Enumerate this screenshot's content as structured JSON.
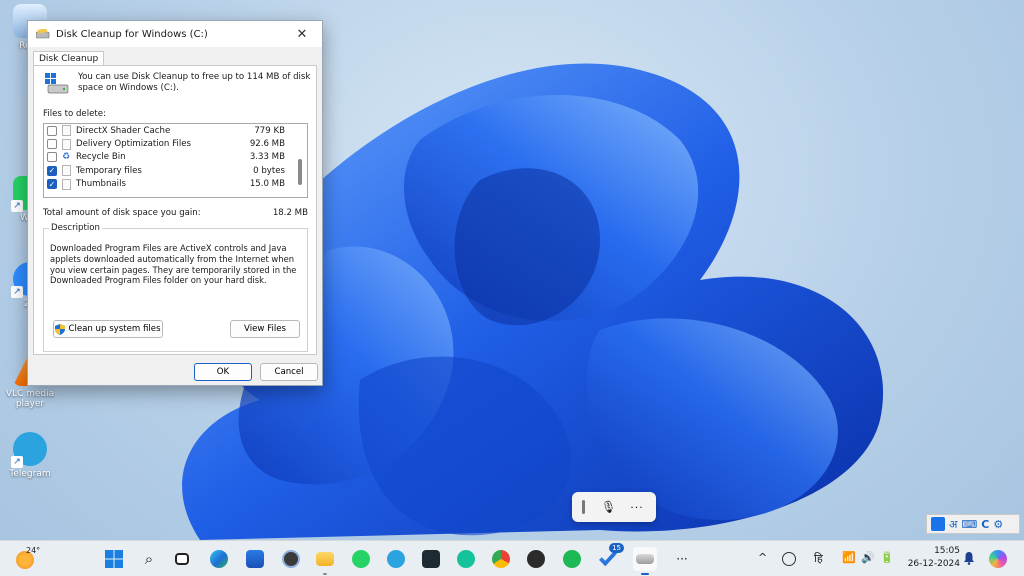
{
  "desktop": {
    "icons": [
      {
        "label": "Recy",
        "name": "recycle-bin"
      },
      {
        "label": "Wha",
        "name": "whatsapp"
      },
      {
        "label": "Zo",
        "name": "zoom"
      },
      {
        "label": "VLC media player",
        "name": "vlc-media-player"
      },
      {
        "label": "Telegram",
        "name": "telegram"
      }
    ]
  },
  "dialog": {
    "title": "Disk Cleanup for Windows (C:)",
    "close_glyph": "✕",
    "tab_label": "Disk Cleanup",
    "intro": "You can use Disk Cleanup to free up to 114 MB of disk space on Windows (C:).",
    "files_label": "Files to delete:",
    "files": [
      {
        "name": "DirectX Shader Cache",
        "size": "779 KB",
        "checked": false
      },
      {
        "name": "Delivery Optimization Files",
        "size": "92.6 MB",
        "checked": false
      },
      {
        "name": "Recycle Bin",
        "size": "3.33 MB",
        "checked": false
      },
      {
        "name": "Temporary files",
        "size": "0 bytes",
        "checked": true
      },
      {
        "name": "Thumbnails",
        "size": "15.0 MB",
        "checked": true
      }
    ],
    "total_label": "Total amount of disk space you gain:",
    "total_value": "18.2 MB",
    "description_legend": "Description",
    "description": "Downloaded Program Files are ActiveX controls and Java applets downloaded automatically from the Internet when you view certain pages. They are temporarily stored in the Downloaded Program Files folder on your hard disk.",
    "cleanup_system_label": "Clean up system files",
    "view_files_label": "View Files",
    "ok_label": "OK",
    "cancel_label": "Cancel"
  },
  "voice_bar": {
    "mic_glyph": "🎙",
    "more_glyph": "···"
  },
  "ime": {
    "hindi": "अ",
    "keyboard": "⌨",
    "c": "C",
    "gear": "⚙"
  },
  "taskbar": {
    "weather_temp": "24°",
    "apps": [
      "start",
      "search",
      "task-view",
      "edge",
      "store",
      "ink",
      "file-explorer",
      "whatsapp",
      "telegram",
      "capcut",
      "grammarly",
      "chrome",
      "obs",
      "spotify",
      "todo",
      "disk-cleanup",
      "overflow"
    ],
    "todo_badge": "15",
    "overflow_glyph": "···",
    "tray": {
      "chevron": "^",
      "lang_glyph": "हि",
      "wifi": "📶",
      "volume": "🔊",
      "battery": "🔋"
    },
    "time": "15:05",
    "date": "26-12-2024"
  },
  "colors": {
    "accent": "#1b5fbf",
    "wallpaper_blue": "#1a5fe0"
  }
}
